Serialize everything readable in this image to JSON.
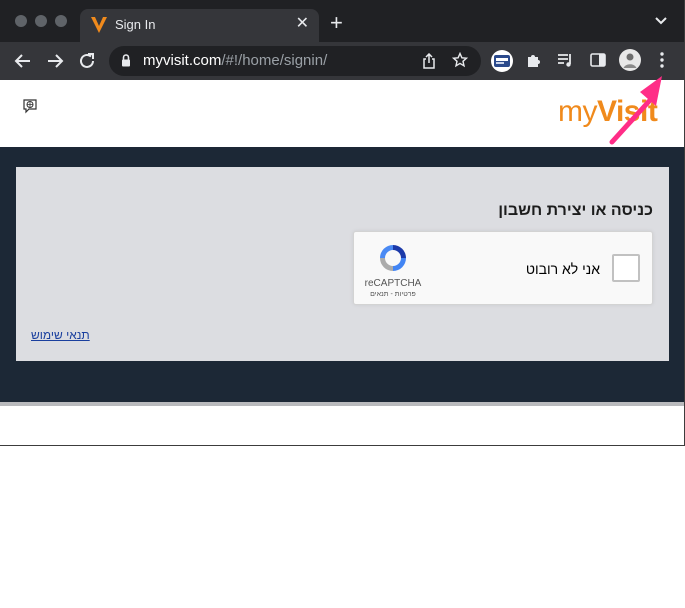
{
  "browser": {
    "tab": {
      "title": "Sign In",
      "close_glyph": "✕"
    },
    "new_tab_glyph": "+",
    "address": {
      "host": "myvisit.com",
      "path": "/#!/home/signin/"
    },
    "colors": {
      "frame": "#202124",
      "toolbar": "#35363a",
      "tab": "#35363a"
    }
  },
  "site": {
    "logo": {
      "my": "my",
      "visit": "Visit"
    },
    "signin_heading": "כניסה או יצירת חשבון",
    "captcha": {
      "label": "אני לא רובוט",
      "brand": "reCAPTCHA",
      "links": "פרטיות - תנאים"
    },
    "terms_link": "תנאי שימוש",
    "colors": {
      "brand_orange": "#f08a1c",
      "band": "#1c2836",
      "card": "#dcdde1",
      "link": "#1a3f9e"
    }
  },
  "annotation": {
    "color": "#ff2d87",
    "target": "browser-menu-button"
  }
}
